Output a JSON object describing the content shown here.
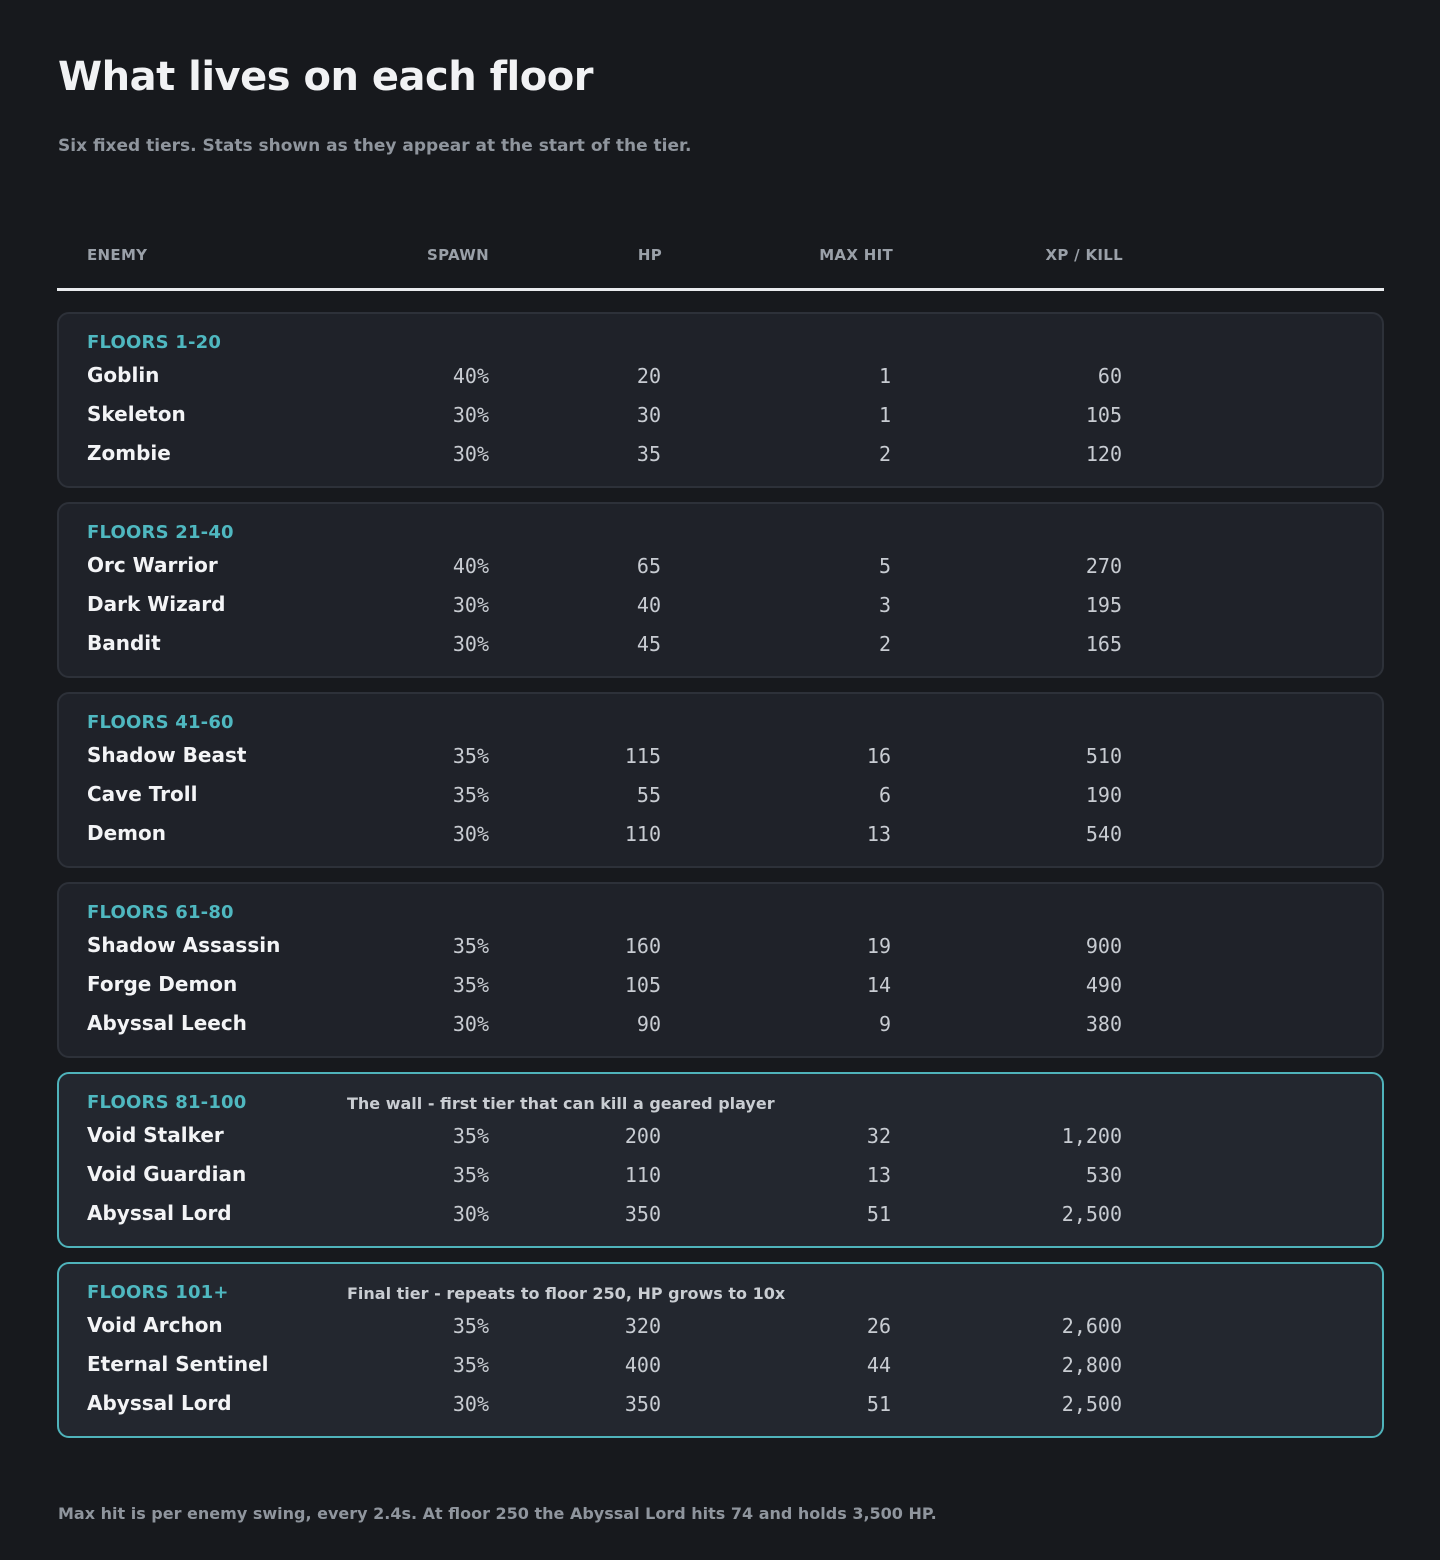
{
  "page": {
    "title": "What lives on each floor",
    "subtitle": "Six fixed tiers. Stats shown as they appear at the start of the tier.",
    "footnote": "Max hit is per enemy swing, every 2.4s. At floor 250 the Abyssal Lord hits 74 and holds 3,500 HP."
  },
  "columns": {
    "enemy": "ENEMY",
    "spawn": "SPAWN",
    "hp": "HP",
    "max_hit": "MAX HIT",
    "xp": "XP / KILL"
  },
  "colors": {
    "background": "#17191d",
    "card": "#1f2229",
    "accent": "#4fb8c0",
    "highlight_border": "#4fb3bb"
  },
  "tiers": [
    {
      "label": "FLOORS 1-20",
      "note": "",
      "highlight": false,
      "enemies": [
        {
          "name": "Goblin",
          "spawn": "40%",
          "hp": "20",
          "max_hit": "1",
          "xp": "60"
        },
        {
          "name": "Skeleton",
          "spawn": "30%",
          "hp": "30",
          "max_hit": "1",
          "xp": "105"
        },
        {
          "name": "Zombie",
          "spawn": "30%",
          "hp": "35",
          "max_hit": "2",
          "xp": "120"
        }
      ]
    },
    {
      "label": "FLOORS 21-40",
      "note": "",
      "highlight": false,
      "enemies": [
        {
          "name": "Orc Warrior",
          "spawn": "40%",
          "hp": "65",
          "max_hit": "5",
          "xp": "270"
        },
        {
          "name": "Dark Wizard",
          "spawn": "30%",
          "hp": "40",
          "max_hit": "3",
          "xp": "195"
        },
        {
          "name": "Bandit",
          "spawn": "30%",
          "hp": "45",
          "max_hit": "2",
          "xp": "165"
        }
      ]
    },
    {
      "label": "FLOORS 41-60",
      "note": "",
      "highlight": false,
      "enemies": [
        {
          "name": "Shadow Beast",
          "spawn": "35%",
          "hp": "115",
          "max_hit": "16",
          "xp": "510"
        },
        {
          "name": "Cave Troll",
          "spawn": "35%",
          "hp": "55",
          "max_hit": "6",
          "xp": "190"
        },
        {
          "name": "Demon",
          "spawn": "30%",
          "hp": "110",
          "max_hit": "13",
          "xp": "540"
        }
      ]
    },
    {
      "label": "FLOORS 61-80",
      "note": "",
      "highlight": false,
      "enemies": [
        {
          "name": "Shadow Assassin",
          "spawn": "35%",
          "hp": "160",
          "max_hit": "19",
          "xp": "900"
        },
        {
          "name": "Forge Demon",
          "spawn": "35%",
          "hp": "105",
          "max_hit": "14",
          "xp": "490"
        },
        {
          "name": "Abyssal Leech",
          "spawn": "30%",
          "hp": "90",
          "max_hit": "9",
          "xp": "380"
        }
      ]
    },
    {
      "label": "FLOORS 81-100",
      "note": "The wall - first tier that can kill a geared player",
      "highlight": true,
      "enemies": [
        {
          "name": "Void Stalker",
          "spawn": "35%",
          "hp": "200",
          "max_hit": "32",
          "xp": "1,200"
        },
        {
          "name": "Void Guardian",
          "spawn": "35%",
          "hp": "110",
          "max_hit": "13",
          "xp": "530"
        },
        {
          "name": "Abyssal Lord",
          "spawn": "30%",
          "hp": "350",
          "max_hit": "51",
          "xp": "2,500"
        }
      ]
    },
    {
      "label": "FLOORS 101+",
      "note": "Final tier - repeats to floor 250, HP grows to 10x",
      "highlight": true,
      "enemies": [
        {
          "name": "Void Archon",
          "spawn": "35%",
          "hp": "320",
          "max_hit": "26",
          "xp": "2,600"
        },
        {
          "name": "Eternal Sentinel",
          "spawn": "35%",
          "hp": "400",
          "max_hit": "44",
          "xp": "2,800"
        },
        {
          "name": "Abyssal Lord",
          "spawn": "30%",
          "hp": "350",
          "max_hit": "51",
          "xp": "2,500"
        }
      ]
    }
  ]
}
